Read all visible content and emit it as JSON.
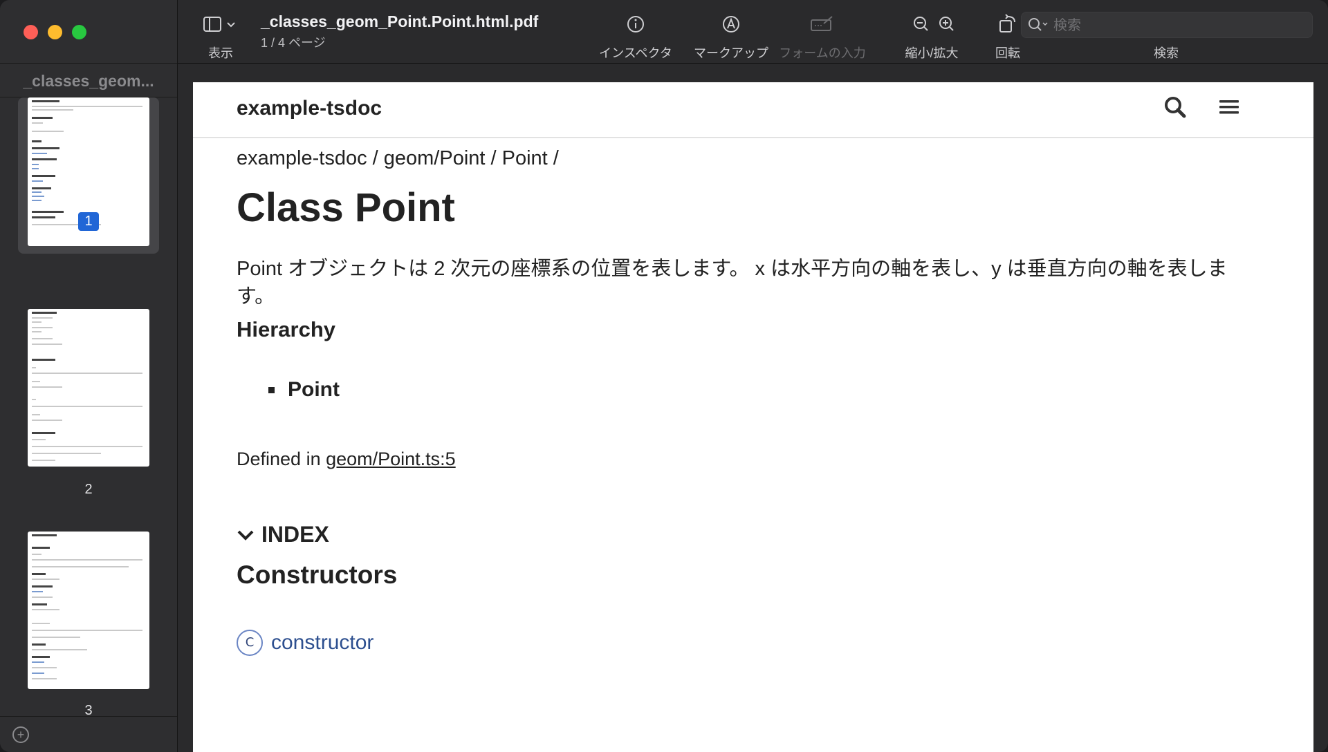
{
  "sidebar": {
    "title": "_classes_geom...",
    "pages": [
      {
        "number": "1",
        "selected": true
      },
      {
        "number": "2",
        "selected": false
      },
      {
        "number": "3",
        "selected": false
      }
    ]
  },
  "toolbar": {
    "view_label": "表示",
    "doc_title": "_classes_geom_Point.Point.html.pdf",
    "page_indicator": "1 / 4 ページ",
    "inspector_label": "インスペクタ",
    "markup_label": "マークアップ",
    "form_label": "フォームの入力",
    "zoom_label": "縮小/拡大",
    "rotate_label": "回転",
    "search_label": "検索",
    "search_placeholder": "検索"
  },
  "document": {
    "brand": "example-tsdoc",
    "breadcrumb": "example-tsdoc / geom/Point / Point /",
    "heading": "Class Point",
    "description": "Point オブジェクトは 2 次元の座標系の位置を表します。 x は水平方向の軸を表し、y は垂直方向の軸を表します。",
    "hierarchy_heading": "Hierarchy",
    "hierarchy_item": "Point",
    "defined_prefix": "Defined in ",
    "defined_link": "geom/Point.ts:5",
    "index_label": "INDEX",
    "constructors_heading": "Constructors",
    "constructor_badge": "C",
    "constructor_link": "constructor"
  },
  "colors": {
    "close": "#fe5f57",
    "minimize": "#febc2e",
    "maximize": "#28c840",
    "selected_page_badge": "#2166d6",
    "link_blue": "#2d4f8f"
  }
}
